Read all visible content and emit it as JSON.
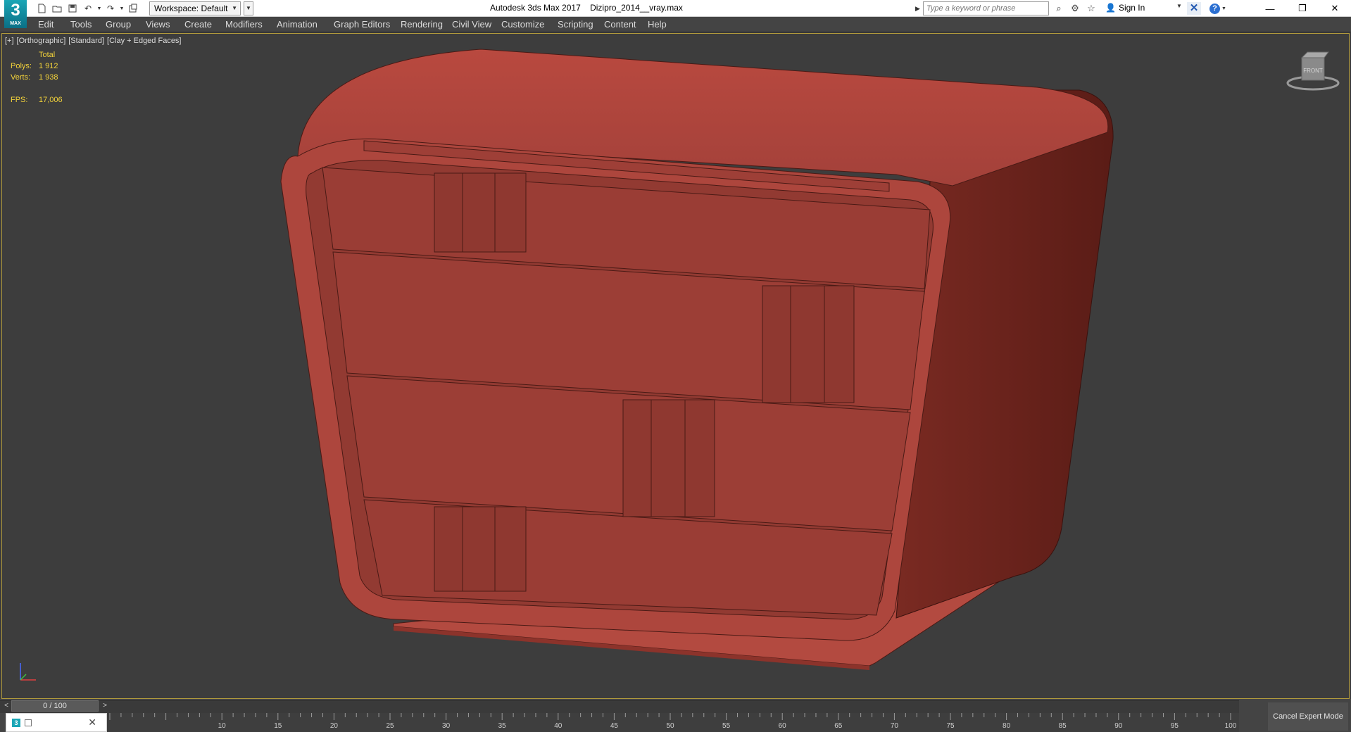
{
  "app": {
    "logo_text": "3",
    "logo_sub": "MAX",
    "title": "Autodesk 3ds Max 2017    Dizipro_2014__vray.max",
    "workspace": "Workspace: Default"
  },
  "search": {
    "placeholder": "Type a keyword or phrase"
  },
  "account": {
    "signin": "Sign In"
  },
  "menu": [
    "Edit",
    "Tools",
    "Group",
    "Views",
    "Create",
    "Modifiers",
    "Animation",
    "Graph Editors",
    "Rendering",
    "Civil View",
    "Customize",
    "Scripting",
    "Content",
    "Help"
  ],
  "viewport": {
    "labels": [
      "[+]",
      "[Orthographic]",
      "[Standard]",
      "[Clay + Edged Faces]"
    ],
    "stats": {
      "header": "Total",
      "polys_label": "Polys:",
      "polys": "1 912",
      "verts_label": "Verts:",
      "verts": "1 938",
      "fps_label": "FPS:",
      "fps": "17,006"
    },
    "viewcube_label": "FRONT",
    "model_color": "#b34a40"
  },
  "timeline": {
    "slider": "0 / 100",
    "prev": "<",
    "next": ">",
    "ticks": [
      "10",
      "15",
      "20",
      "25",
      "30",
      "35",
      "40",
      "45",
      "50",
      "55",
      "60",
      "65",
      "70",
      "75",
      "80",
      "85",
      "90",
      "95",
      "100"
    ]
  },
  "cancel_expert": "Cancel Expert Mode",
  "colors": {
    "stats": "#f2d23a",
    "viewport_border": "#b29b3c",
    "logo": "#1aa6b6"
  }
}
